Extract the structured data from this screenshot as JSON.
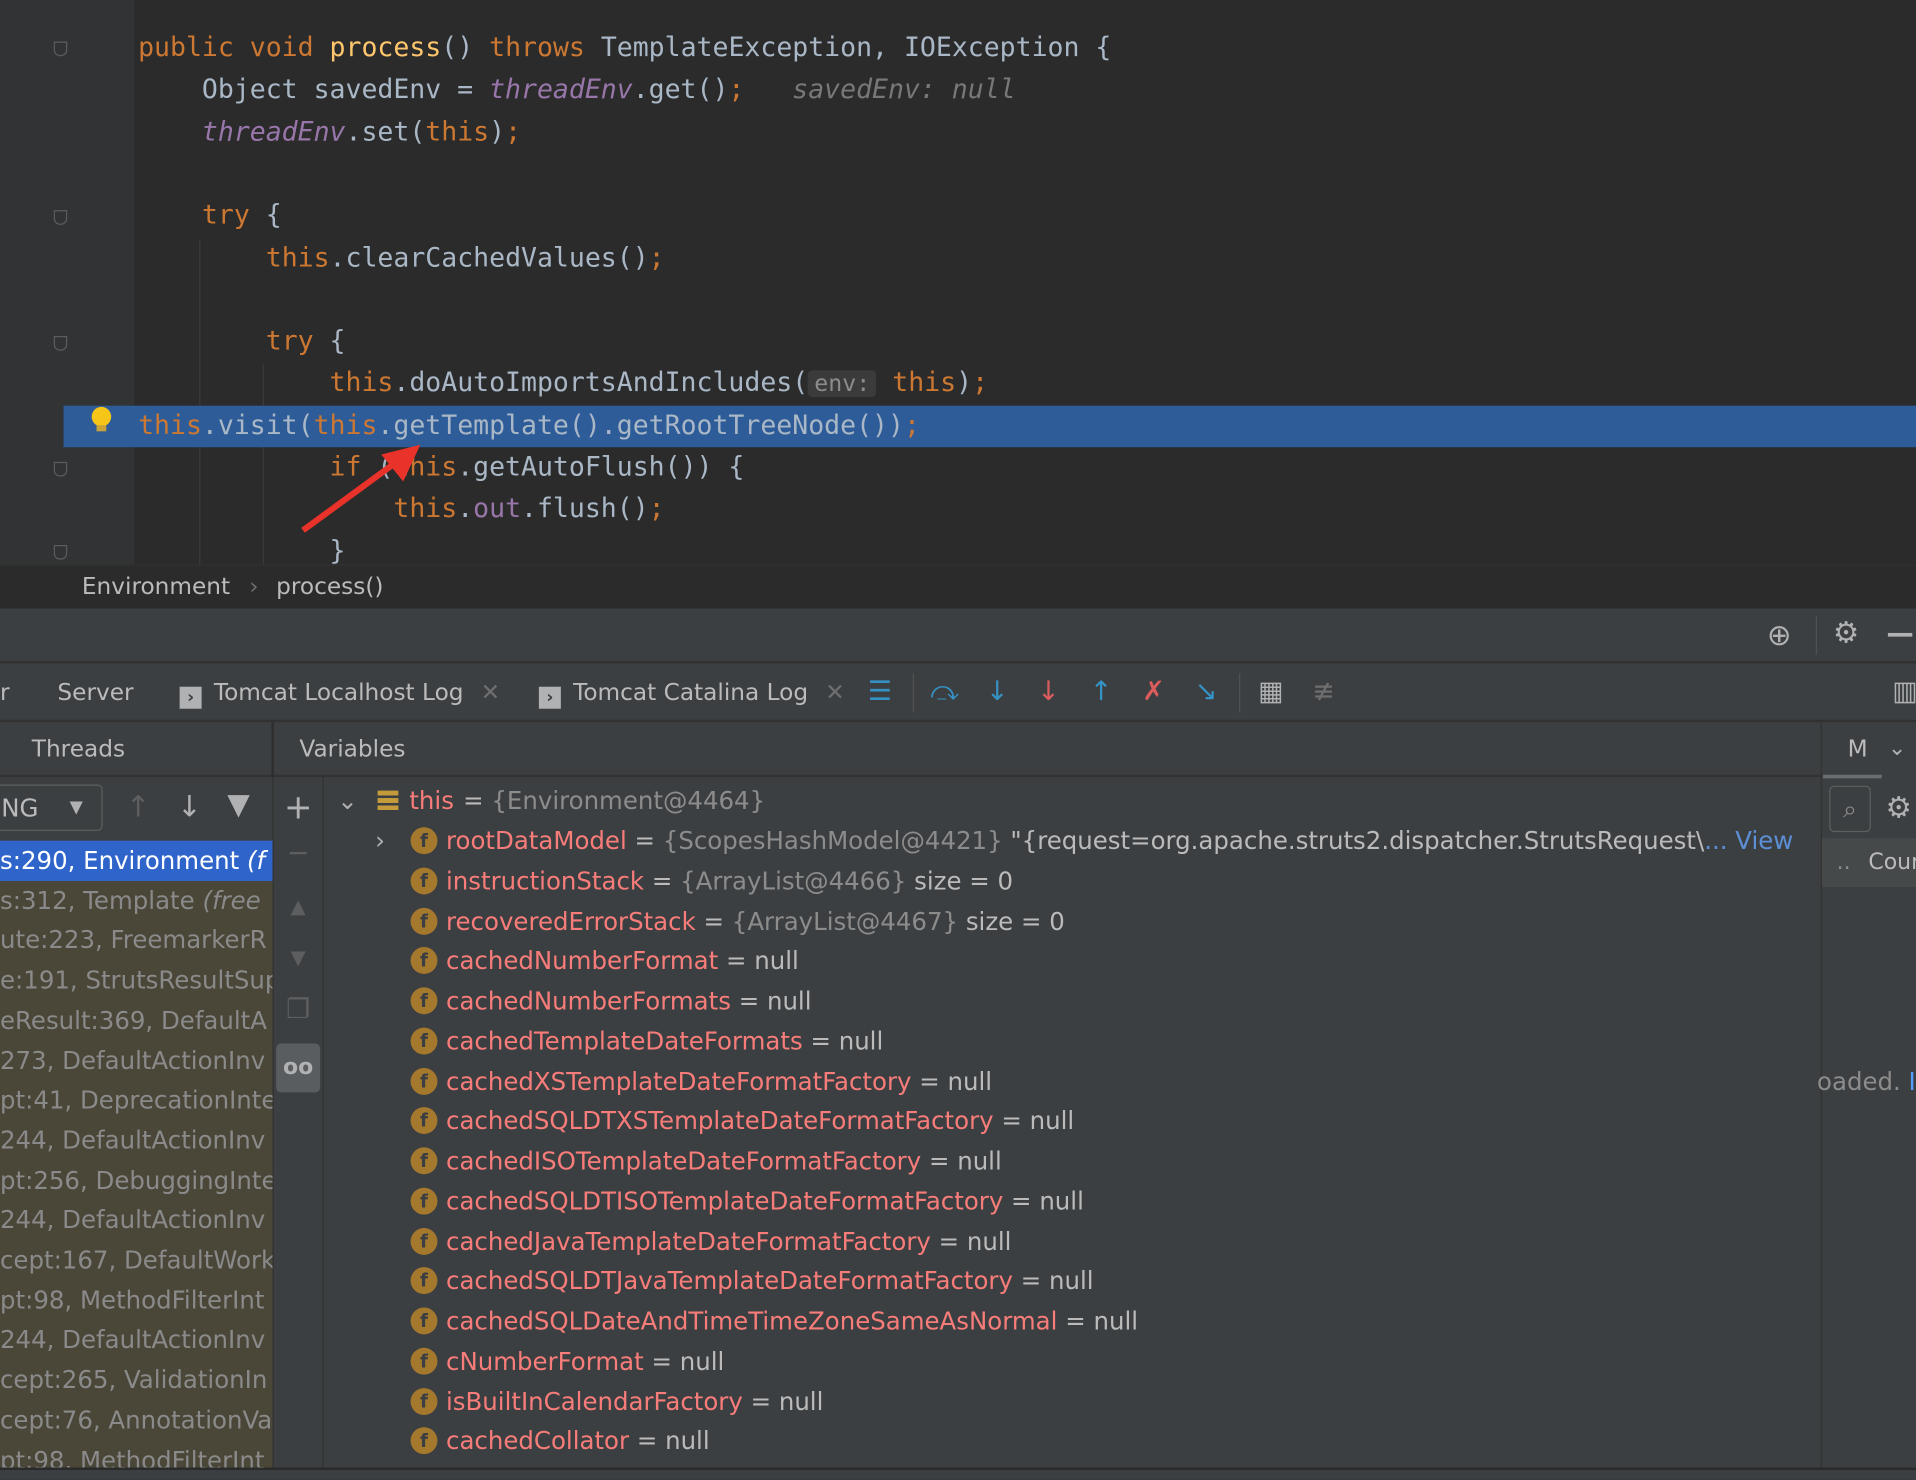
{
  "editor": {
    "lines": [
      {
        "tokens": [
          [
            "public ",
            "kw"
          ],
          [
            "void ",
            "kw"
          ],
          [
            "process",
            "fn"
          ],
          [
            "() ",
            ""
          ],
          [
            "throws ",
            "kw"
          ],
          [
            "TemplateException, IOException {",
            ""
          ]
        ]
      },
      {
        "tokens": [
          [
            "    Object savedEnv = ",
            ""
          ],
          [
            "threadEnv",
            "fld"
          ],
          [
            ".get()",
            ""
          ],
          [
            ";",
            "kw"
          ],
          [
            "   savedEnv: null",
            "cm"
          ]
        ]
      },
      {
        "tokens": [
          [
            "    ",
            ""
          ],
          [
            "threadEnv",
            "fld"
          ],
          [
            ".set(",
            ""
          ],
          [
            "this",
            "kw"
          ],
          [
            ")",
            ""
          ],
          [
            ";",
            "kw"
          ]
        ]
      },
      {
        "tokens": []
      },
      {
        "tokens": [
          [
            "    ",
            ""
          ],
          [
            "try ",
            "kw"
          ],
          [
            "{",
            ""
          ]
        ]
      },
      {
        "tokens": [
          [
            "        ",
            ""
          ],
          [
            "this",
            "kw"
          ],
          [
            ".clearCachedValues()",
            ""
          ],
          [
            ";",
            "kw"
          ]
        ]
      },
      {
        "tokens": []
      },
      {
        "tokens": [
          [
            "        ",
            ""
          ],
          [
            "try ",
            "kw"
          ],
          [
            "{",
            ""
          ]
        ]
      },
      {
        "tokens": [
          [
            "            ",
            ""
          ],
          [
            "this",
            "kw"
          ],
          [
            ".doAutoImportsAndIncludes(",
            ""
          ],
          [
            "env:",
            "hint"
          ],
          [
            " ",
            ""
          ],
          [
            "this",
            "kw"
          ],
          [
            ")",
            ""
          ],
          [
            ";",
            "kw"
          ]
        ]
      },
      {
        "tokens": [
          [
            "this",
            "kw"
          ],
          [
            ".visit(",
            ""
          ],
          [
            "this",
            "kw"
          ],
          [
            ".getTemplate().getRootTreeNode())",
            ""
          ],
          [
            ";",
            "kw"
          ]
        ],
        "highlighted": true
      },
      {
        "tokens": [
          [
            "            ",
            ""
          ],
          [
            "if ",
            "kw"
          ],
          [
            "(",
            ""
          ],
          [
            "this",
            "kw"
          ],
          [
            ".getAutoFlush()) {",
            ""
          ]
        ]
      },
      {
        "tokens": [
          [
            "                ",
            ""
          ],
          [
            "this",
            "kw"
          ],
          [
            ".",
            ""
          ],
          [
            "out",
            "fld2"
          ],
          [
            ".flush()",
            ""
          ],
          [
            ";",
            "kw"
          ]
        ]
      },
      {
        "tokens": [
          [
            "            }",
            ""
          ]
        ]
      }
    ]
  },
  "breadcrumb": {
    "items": [
      "Environment",
      "process()"
    ],
    "separator": "›"
  },
  "tabs": [
    {
      "label": "r"
    },
    {
      "label": "Server"
    },
    {
      "label": "Tomcat Localhost Log",
      "closable": true
    },
    {
      "label": "Tomcat Catalina Log",
      "closable": true
    }
  ],
  "panels": {
    "threads": "Threads",
    "variables": "Variables",
    "right_tab": "M"
  },
  "threads": {
    "selector_value": "NG",
    "frames": [
      {
        "text": "s:290, Environment ",
        "pkg": "(f",
        "selected": true
      },
      {
        "text": "s:312, Template ",
        "pkg": "(free"
      },
      {
        "text": "ute:223, FreemarkerR"
      },
      {
        "text": "e:191, StrutsResultSup"
      },
      {
        "text": "eResult:369, DefaultA"
      },
      {
        "text": "273, DefaultActionInv"
      },
      {
        "text": "pt:41, DeprecationInte"
      },
      {
        "text": "244, DefaultActionInv"
      },
      {
        "text": "pt:256, DebuggingInte"
      },
      {
        "text": "244, DefaultActionInv"
      },
      {
        "text": "cept:167, DefaultWork"
      },
      {
        "text": "pt:98, MethodFilterInt"
      },
      {
        "text": "244, DefaultActionInv"
      },
      {
        "text": "cept:265, ValidationIn"
      },
      {
        "text": "cept:76, AnnotationVa"
      },
      {
        "text": "pt:98, MethodFilterInt"
      }
    ]
  },
  "variables": {
    "root": {
      "name": "this",
      "eq": " = ",
      "ref": "{Environment@4464}"
    },
    "items": [
      {
        "name": "rootDataModel",
        "ref": "{ScopesHashModel@4421}",
        "value": " \"{request=org.apache.struts2.dispatcher.StrutsRequest\\",
        "link": "... View",
        "expandable": true
      },
      {
        "name": "instructionStack",
        "ref": "{ArrayList@4466}",
        "value": "  size = 0"
      },
      {
        "name": "recoveredErrorStack",
        "ref": "{ArrayList@4467}",
        "value": "  size = 0"
      },
      {
        "name": "cachedNumberFormat",
        "value": "null"
      },
      {
        "name": "cachedNumberFormats",
        "value": "null"
      },
      {
        "name": "cachedTemplateDateFormats",
        "value": "null"
      },
      {
        "name": "cachedXSTemplateDateFormatFactory",
        "value": "null"
      },
      {
        "name": "cachedSQLDTXSTemplateDateFormatFactory",
        "value": "null"
      },
      {
        "name": "cachedISOTemplateDateFormatFactory",
        "value": "null"
      },
      {
        "name": "cachedSQLDTISOTemplateDateFormatFactory",
        "value": "null"
      },
      {
        "name": "cachedJavaTemplateDateFormatFactory",
        "value": "null"
      },
      {
        "name": "cachedSQLDTJavaTemplateDateFormatFactory",
        "value": "null"
      },
      {
        "name": "cachedSQLDateAndTimeTimeZoneSameAsNormal",
        "value": "null"
      },
      {
        "name": "cNumberFormat",
        "value": "null"
      },
      {
        "name": "isBuiltInCalendarFactory",
        "value": "null"
      },
      {
        "name": "cachedCollator",
        "value": "null"
      }
    ],
    "field_icon": "f"
  },
  "right_panel": {
    "column": "Cour",
    "dots": "..",
    "message": "oaded."
  },
  "colors": {
    "highlight": "#2d5c99",
    "selected_frame": "#2f65ca",
    "field_name": "#f87d7a",
    "keyword": "#cc7832"
  }
}
